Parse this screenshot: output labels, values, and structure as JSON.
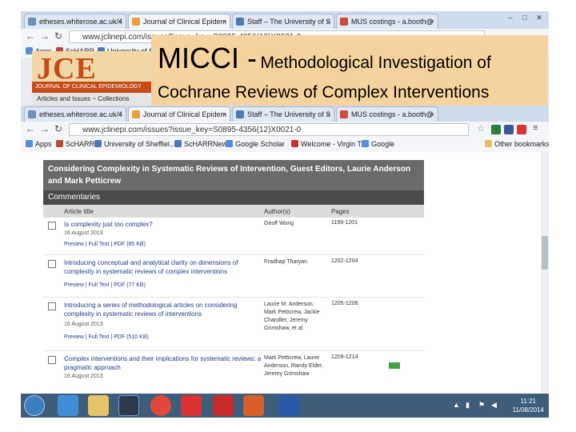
{
  "slide": {
    "title_big": "MICCI -",
    "title_rest": "Methodological Investigation of",
    "title_line2": "Cochrane Reviews of Complex Interventions"
  },
  "bg_browser": {
    "tabs": [
      {
        "label": "etheses.whiterose.ac.uk/4",
        "color": "#6b8fbf"
      },
      {
        "label": "Journal of Clinical Epidem",
        "color": "#e7a23c"
      },
      {
        "label": "Staff – The University of S",
        "color": "#4d7ab5"
      },
      {
        "label": "MUS costings - a.booth@",
        "color": "#d24a3b"
      }
    ],
    "url": "www.jclinepi.com/issues?issue_key=S0895-4356(12)X0021-0",
    "bookmarks": [
      "Apps",
      "ScHARR",
      "University of Shef"
    ],
    "logo_letters": "JCE",
    "logo_sub": "JOURNAL OF CLINICAL EPIDEMIOLOGY",
    "logo_nav": "Articles and Issues ~   Collections"
  },
  "fg_browser": {
    "tabs": [
      {
        "label": "etheses.whiterose.ac.uk/4",
        "color": "#6b8fbf"
      },
      {
        "label": "Journal of Clinical Epidem",
        "color": "#e7a23c"
      },
      {
        "label": "Staff – The University of S",
        "color": "#4d7ab5"
      },
      {
        "label": "MUS costings - a.booth@",
        "color": "#d24a3b"
      }
    ],
    "url": "www.jclinepi.com/issues?issue_key=S0895-4356(12)X0021-0",
    "bookmarks": [
      {
        "label": "Apps",
        "color": "#5a8dd6"
      },
      {
        "label": "ScHARR",
        "color": "#b34b3b"
      },
      {
        "label": "University of Sheffiel...",
        "color": "#4d7ab5"
      },
      {
        "label": "ScHARRNews",
        "color": "#4d7ab5"
      },
      {
        "label": "Google Scholar",
        "color": "#5a8dd6"
      },
      {
        "label": "Welcome - Virgin T...",
        "color": "#c83030"
      },
      {
        "label": "Google",
        "color": "#5a8dd6"
      }
    ],
    "other_bookmarks": "Other bookmarks"
  },
  "issue": {
    "header": "Considering Complexity in Systematic Reviews of Intervention, Guest Editors, Laurie Anderson and Mark Petticrew",
    "section": "Commentaries",
    "col_title": "Article title",
    "col_authors": "Author(s)",
    "col_pages": "Pages"
  },
  "articles": [
    {
      "title": "Is complexity just too complex?",
      "date": "16 August 2013",
      "links": "Preview | Full Text | PDF (85 KB)",
      "authors": "Geoff Wong",
      "pages": "1199-1201"
    },
    {
      "title": "Introducing conceptual and analytical clarity on dimensions of complexity in systematic reviews of complex interventions",
      "date": "16 August 2013",
      "links": "Preview | Full Text | PDF (77 KB)",
      "authors": "Pradhap Tharyan",
      "pages": "1202-1204"
    },
    {
      "title": "Introducing a series of methodological articles on considering complexity in systematic reviews of interventions",
      "date": "16 August 2013",
      "links": "Preview | Full Text | PDF (510 KB)",
      "authors": "Laurie M. Anderson, Mark Petticrew, Jackie Chandler, Jeremy Grimshaw, et al.",
      "pages": "1205-1208"
    },
    {
      "title": "Complex interventions and their implications for systematic reviews: a pragmatic approach",
      "date": "16 August 2013",
      "links": "",
      "authors": "Mark Petticrew, Laurie Anderson, Randy Elder, Jeremy Grimshaw",
      "pages": "1209-1214"
    }
  ],
  "taskbar": {
    "time": "11:21",
    "date": "11/08/2014"
  }
}
